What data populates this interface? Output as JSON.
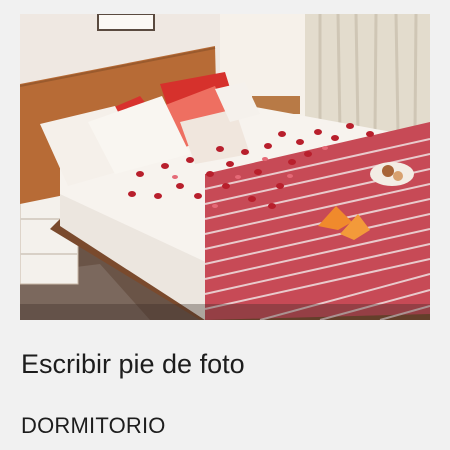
{
  "photo": {
    "subject_icon": "bedroom-photo"
  },
  "caption": {
    "placeholder": "Escribir pie de foto"
  },
  "album": {
    "label": "DORMITORIO"
  }
}
